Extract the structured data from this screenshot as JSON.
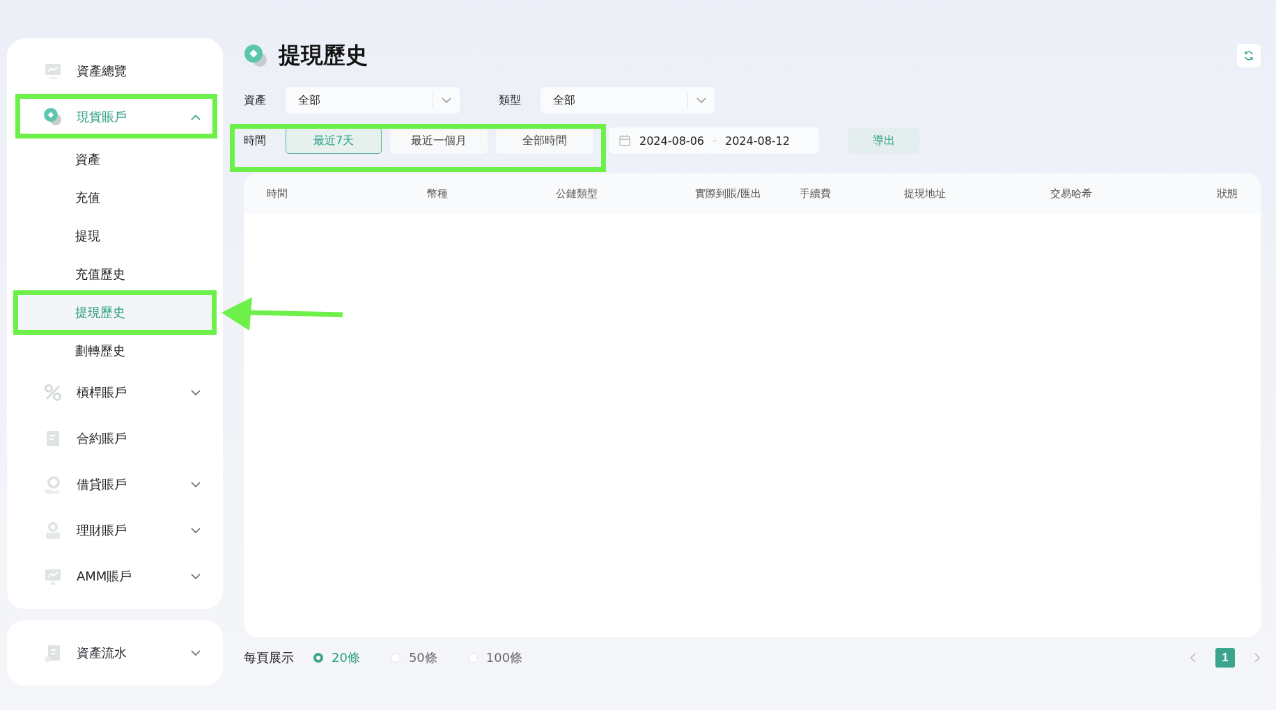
{
  "sidebar": {
    "items": [
      {
        "label": "資產總覽",
        "kind": "link",
        "selected": false
      },
      {
        "label": "現貨賬戶",
        "kind": "group",
        "selected": true,
        "expanded": true,
        "children": [
          {
            "label": "資產",
            "selected": false
          },
          {
            "label": "充值",
            "selected": false
          },
          {
            "label": "提現",
            "selected": false
          },
          {
            "label": "充值歷史",
            "selected": false
          },
          {
            "label": "提現歷史",
            "selected": true
          },
          {
            "label": "劃轉歷史",
            "selected": false
          }
        ]
      },
      {
        "label": "槓桿賬戶",
        "kind": "group",
        "selected": false,
        "expanded": false
      },
      {
        "label": "合約賬戶",
        "kind": "link",
        "selected": false
      },
      {
        "label": "借貸賬戶",
        "kind": "group",
        "selected": false,
        "expanded": false
      },
      {
        "label": "理財賬戶",
        "kind": "group",
        "selected": false,
        "expanded": false
      },
      {
        "label": "AMM賬戶",
        "kind": "group",
        "selected": false,
        "expanded": false
      }
    ],
    "footer_items": [
      {
        "label": "資產流水",
        "kind": "group",
        "selected": false,
        "expanded": false
      }
    ]
  },
  "page": {
    "title": "提現歷史"
  },
  "filters": {
    "selects": [
      {
        "label": "資產",
        "value": "全部"
      },
      {
        "label": "類型",
        "value": "全部"
      }
    ],
    "time": {
      "label": "時間",
      "options": [
        {
          "label": "最近7天",
          "selected": true
        },
        {
          "label": "最近一個月",
          "selected": false
        },
        {
          "label": "全部時間",
          "selected": false
        }
      ]
    },
    "date_range": {
      "start": "2024-08-06",
      "separator": "–",
      "end": "2024-08-12"
    },
    "export_button": "導出"
  },
  "table": {
    "columns": [
      "時間",
      "幣種",
      "公鏈類型",
      "實際到賬/匯出",
      "手續費",
      "提現地址",
      "交易哈希",
      "狀態"
    ]
  },
  "footer": {
    "page_size_label": "每頁展示",
    "page_sizes": [
      {
        "label": "20條",
        "selected": true
      },
      {
        "label": "50條",
        "selected": false
      },
      {
        "label": "100條",
        "selected": false
      }
    ],
    "pages": [
      {
        "label": "1",
        "selected": true
      }
    ]
  }
}
